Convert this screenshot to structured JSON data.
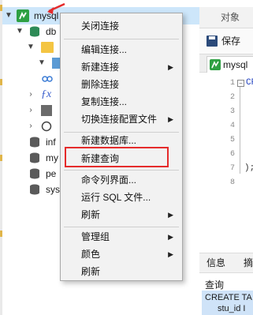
{
  "tree": {
    "connection": "mysql",
    "items": [
      {
        "label": "db"
      },
      {
        "label": ""
      },
      {
        "label": ""
      },
      {
        "label": ""
      },
      {
        "label": ""
      },
      {
        "label": ""
      },
      {
        "label": "inf"
      },
      {
        "label": "my"
      },
      {
        "label": "pe"
      },
      {
        "label": "sys"
      }
    ]
  },
  "right_panel": {
    "tab_label": "对象",
    "save_label": "保存",
    "query_tab_label": "mysql",
    "code_fragment": "CR",
    "code_tail": ");",
    "line_numbers": [
      "1",
      "2",
      "3",
      "4",
      "5",
      "6",
      "7",
      "8"
    ],
    "bottom_tabs": [
      "信息",
      "摘"
    ],
    "query_label": "查询",
    "query_text_1": "CREATE TA",
    "query_text_2": "stu_id I"
  },
  "context_menu": {
    "items": [
      {
        "label": "关闭连接",
        "submenu": false
      },
      {
        "label": "编辑连接...",
        "submenu": false
      },
      {
        "label": "新建连接",
        "submenu": true
      },
      {
        "label": "删除连接",
        "submenu": false
      },
      {
        "label": "复制连接...",
        "submenu": false
      },
      {
        "label": "切换连接配置文件",
        "submenu": true
      },
      {
        "label": "新建数据库...",
        "submenu": false
      },
      {
        "label": "新建查询",
        "submenu": false
      },
      {
        "label": "命令列界面...",
        "submenu": false
      },
      {
        "label": "运行 SQL 文件...",
        "submenu": false
      },
      {
        "label": "刷新",
        "submenu": true
      },
      {
        "label": "管理组",
        "submenu": true
      },
      {
        "label": "颜色",
        "submenu": true
      },
      {
        "label": "刷新",
        "submenu": false
      }
    ],
    "highlighted_item": "新建查询",
    "submenu_arrow": "▶"
  },
  "colors": {
    "selection": "#cde6fa",
    "highlight_box": "#e52b2b",
    "connection_icon": "#2ea043",
    "db_icon": "#5a5a5a"
  }
}
